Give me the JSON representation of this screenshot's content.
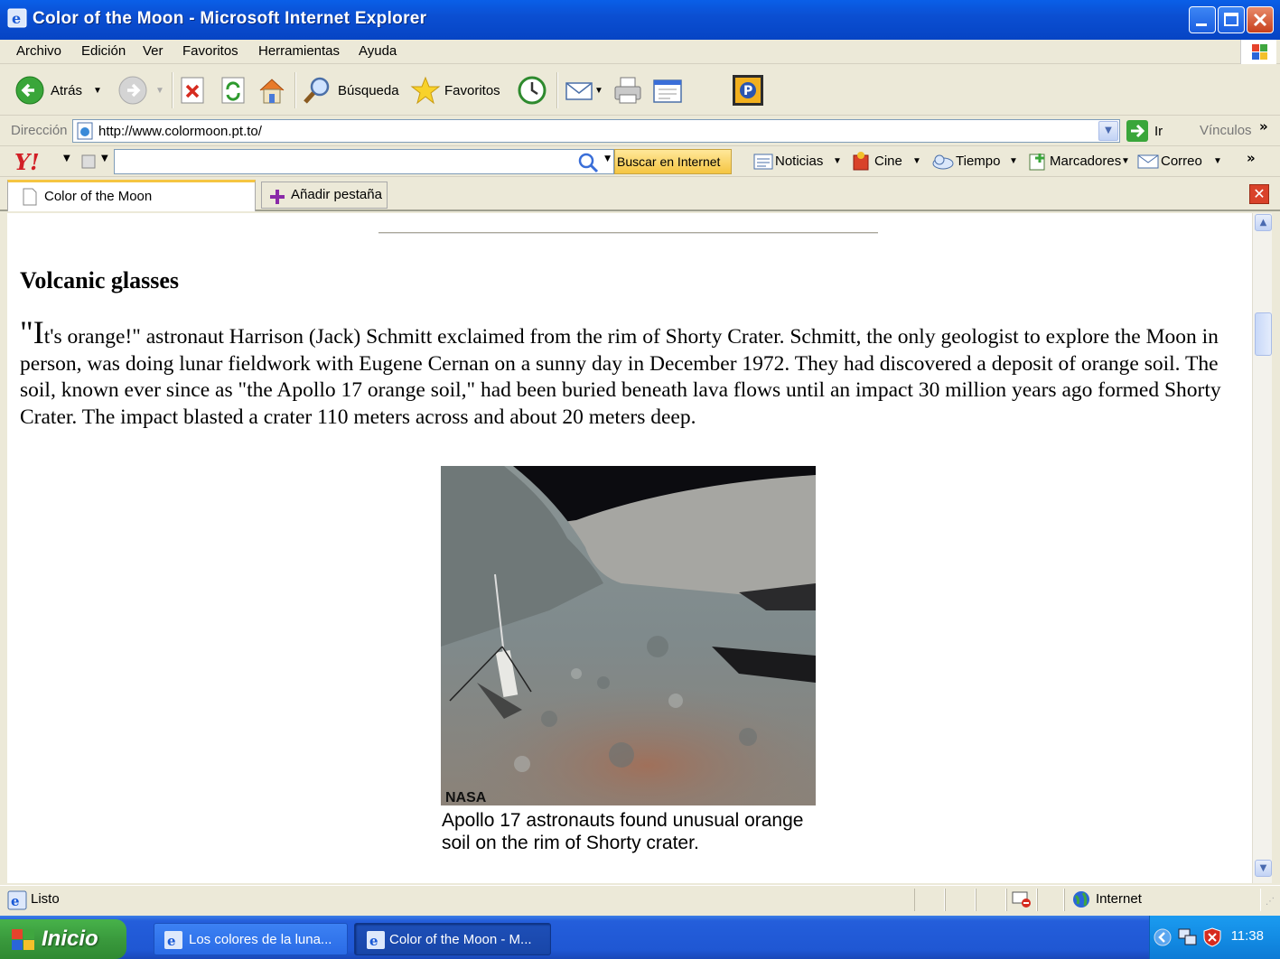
{
  "window": {
    "title": "Color of the Moon - Microsoft Internet Explorer"
  },
  "menu": [
    "Archivo",
    "Edición",
    "Ver",
    "Favoritos",
    "Herramientas",
    "Ayuda"
  ],
  "toolbar": {
    "back_label": "Atrás",
    "search_label": "Búsqueda",
    "favorites_label": "Favoritos"
  },
  "address": {
    "label": "Dirección",
    "url": "http://www.colormoon.pt.to/",
    "go_label": "Ir",
    "links_label": "Vínculos"
  },
  "yahoo": {
    "search_button": "Buscar en Internet",
    "items": [
      "Noticias",
      "Cine",
      "Tiempo",
      "Marcadores",
      "Correo"
    ]
  },
  "tabs": {
    "active_tab": "Color of the Moon",
    "add_tab": "Añadir pestaña"
  },
  "page": {
    "heading": "Volcanic glasses",
    "para_open": "\"",
    "para_cap": "I",
    "para_rest": "t's orange!\" astronaut Harrison (Jack) Schmitt exclaimed from the rim of Shorty Crater. Schmitt, the only geologist to explore the Moon in person, was doing lunar fieldwork with Eugene Cernan on a sunny day in December 1972. They had discovered a deposit of orange soil. The soil, known ever since as \"the Apollo 17 orange soil,\" had been buried beneath lava flows until an impact 30 million years ago formed Shorty Crater. The impact blasted a crater 110 meters across and about 20 meters deep.",
    "photo_credit": "NASA",
    "caption": "Apollo 17 astronauts found unusual orange soil on the rim of Shorty crater."
  },
  "status": {
    "text": "Listo",
    "zone": "Internet"
  },
  "taskbar": {
    "start": "Inicio",
    "task1": "Los colores de la luna...",
    "task2": "Color of the Moon - M...",
    "clock": "11:38"
  }
}
